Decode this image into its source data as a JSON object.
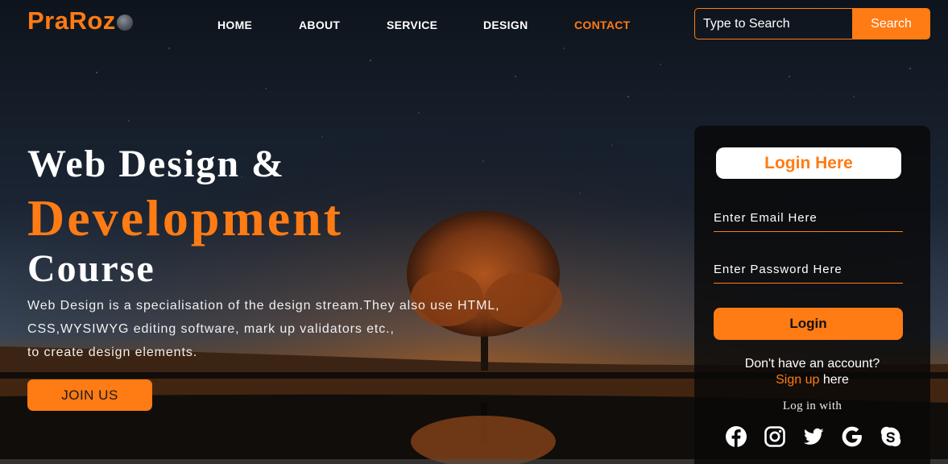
{
  "brand": {
    "name": "PraRoz"
  },
  "nav": {
    "items": [
      {
        "label": "HOME"
      },
      {
        "label": "ABOUT"
      },
      {
        "label": "SERVICE"
      },
      {
        "label": "DESIGN"
      },
      {
        "label": "CONTACT"
      }
    ],
    "active_index": 4
  },
  "search": {
    "placeholder": "Type to Search",
    "button_label": "Search"
  },
  "hero": {
    "line1": "Web Design &",
    "line2": "Development",
    "line3": "Course",
    "description": [
      "Web Design is a specialisation of the design stream.They also use HTML,",
      "CSS,WYSIWYG editing software, mark up validators etc.,",
      "to create design elements."
    ],
    "cta_label": "JOIN US"
  },
  "login": {
    "title": "Login Here",
    "email_placeholder": "Enter Email Here",
    "password_placeholder": "Enter Password Here",
    "button_label": "Login",
    "no_account_text": "Don't have an account?",
    "signup_link": "Sign up",
    "signup_suffix": " here",
    "login_with": "Log in with",
    "socials": [
      "facebook-icon",
      "instagram-icon",
      "twitter-icon",
      "google-icon",
      "skype-icon"
    ]
  },
  "colors": {
    "accent": "#ff7b14",
    "background": "#0d1219",
    "card": "#080808"
  }
}
